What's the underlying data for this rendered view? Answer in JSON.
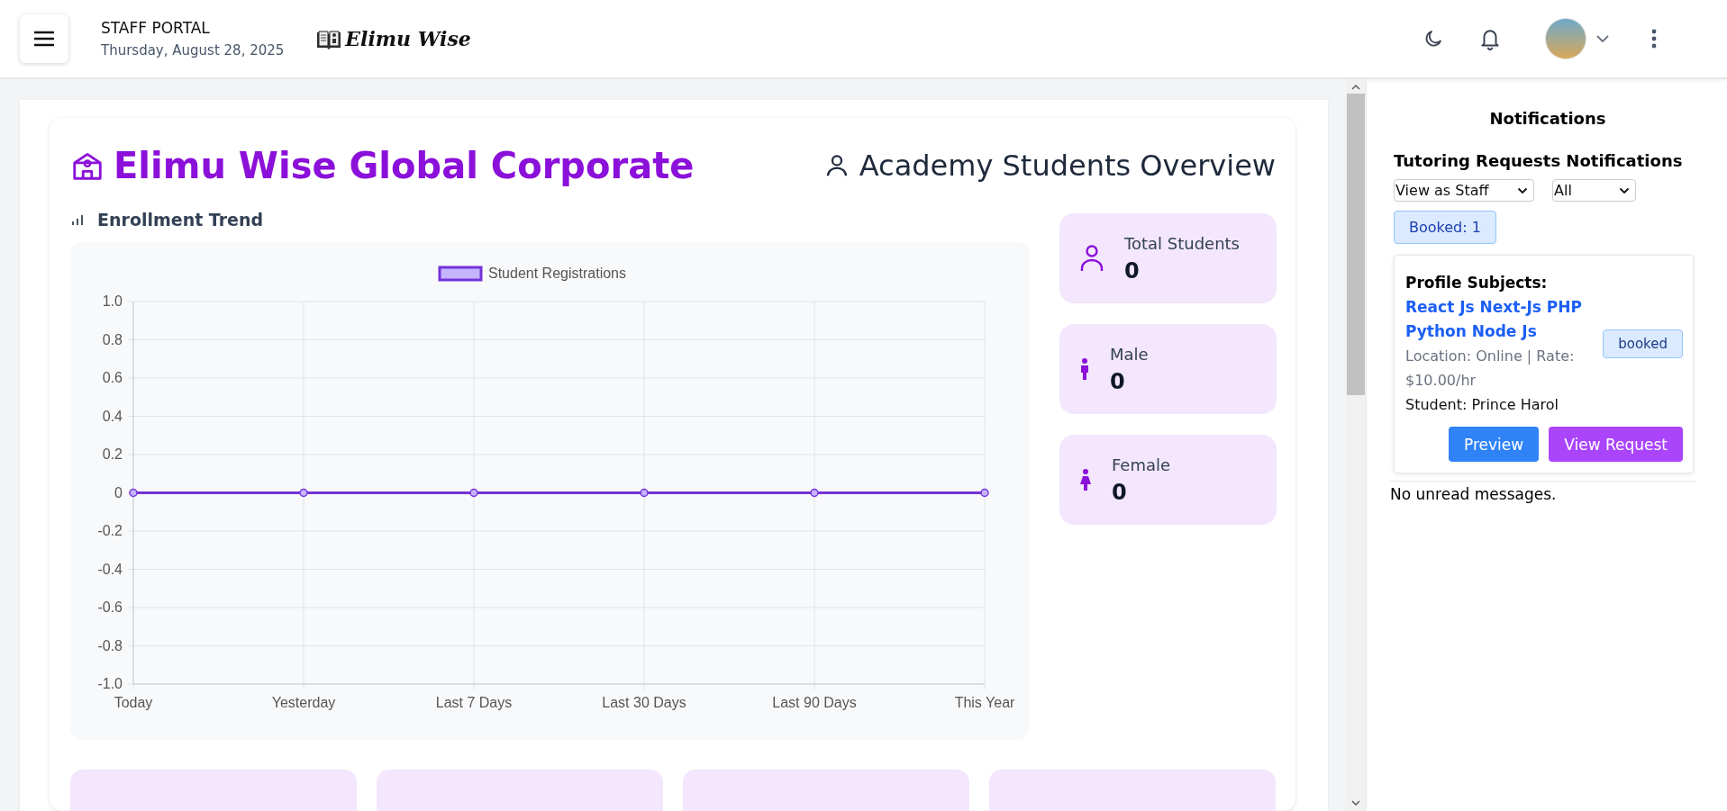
{
  "header": {
    "portal_title": "STAFF PORTAL",
    "date": "Thursday, August 28, 2025",
    "brand": "Elimu Wise"
  },
  "dashboard": {
    "title": "Elimu Wise Global Corporate",
    "overview_title": "Academy Students Overview",
    "chart_title": "Enrollment Trend",
    "chart_data": {
      "type": "line",
      "categories": [
        "Today",
        "Yesterday",
        "Last 7 Days",
        "Last 30 Days",
        "Last 90 Days",
        "This Year"
      ],
      "grid": true,
      "series": [
        {
          "name": "Student Registrations",
          "color": "#7433d9",
          "marker": "circle",
          "values": [
            0,
            0,
            0,
            0,
            0,
            0
          ]
        }
      ],
      "ylim": [
        -1,
        1
      ],
      "yticks": [
        {
          "value": 1,
          "label": "1.0"
        },
        {
          "value": 0.8,
          "label": "0.8"
        },
        {
          "value": 0.6,
          "label": "0.6"
        },
        {
          "value": 0.4,
          "label": "0.4"
        },
        {
          "value": 0.2,
          "label": "0.2"
        },
        {
          "value": 0,
          "label": "0"
        },
        {
          "value": -0.2,
          "label": "-0.2"
        },
        {
          "value": -0.4,
          "label": "-0.4"
        },
        {
          "value": -0.6,
          "label": "-0.6"
        },
        {
          "value": -0.8,
          "label": "-0.8"
        },
        {
          "value": -1,
          "label": "-1.0"
        }
      ]
    },
    "stats": [
      {
        "kind": "total",
        "label": "Total Students",
        "value": "0"
      },
      {
        "kind": "male",
        "label": "Male",
        "value": "0"
      },
      {
        "kind": "female",
        "label": "Female",
        "value": "0"
      }
    ]
  },
  "notifications": {
    "title": "Notifications",
    "section_title": "Tutoring Requests Notifications",
    "view_select": "View as Staff",
    "filter_select": "All",
    "count_badge": "Booked: 1",
    "requests": [
      {
        "heading": "Profile Subjects:",
        "subjects": "React Js Next-Js PHP Python Node Js",
        "details": "Location: Online | Rate: $10.00/hr",
        "student": "Student: Prince Harol",
        "status": "booked",
        "preview_button": "Preview",
        "view_button": "View Request"
      }
    ],
    "empty_message": "No unread messages."
  }
}
